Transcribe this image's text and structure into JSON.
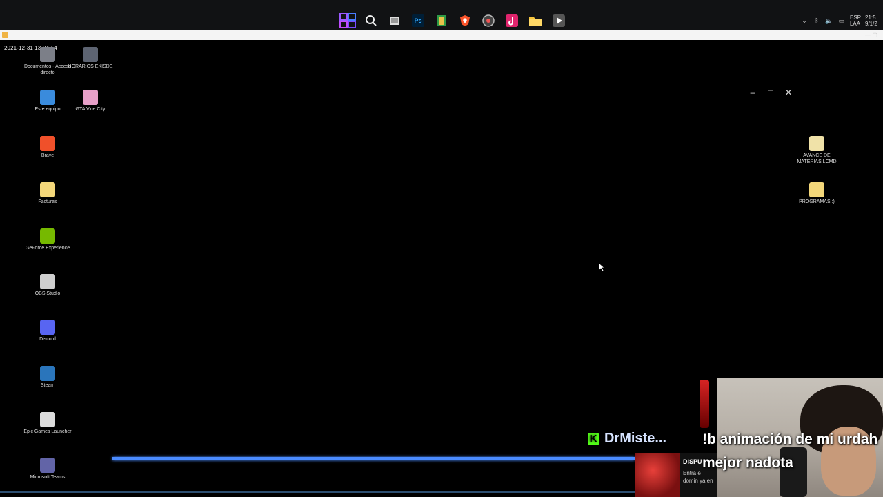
{
  "taskbar": {
    "apps": [
      {
        "name": "start",
        "icon": "windows-start-icon"
      },
      {
        "name": "search",
        "icon": "search-icon"
      },
      {
        "name": "task-view",
        "icon": "task-view-icon"
      },
      {
        "name": "photoshop",
        "icon": "photoshop-icon",
        "text": "Ps"
      },
      {
        "name": "app-green",
        "icon": "app-icon"
      },
      {
        "name": "brave",
        "icon": "brave-icon"
      },
      {
        "name": "app-grey",
        "icon": "app-icon"
      },
      {
        "name": "tiktok",
        "icon": "tiktok-icon"
      },
      {
        "name": "file-explorer",
        "icon": "folder-icon"
      },
      {
        "name": "player",
        "icon": "play-icon"
      }
    ],
    "tray": {
      "language_line1": "ESP",
      "language_line2": "LAA",
      "time": "21:5",
      "date": "9/1/2"
    }
  },
  "timestamp": "2021-12-31 13-34-54",
  "desktop_icons": [
    {
      "label": "Documentos - Acceso directo",
      "icon": "documents-shortcut-icon",
      "color": "#7c7f88"
    },
    {
      "label": "HORARIOS EKISDE",
      "icon": "file-icon",
      "color": "#5d6472"
    },
    {
      "label": "Este equipo",
      "icon": "computer-icon",
      "color": "#3a8bdc"
    },
    {
      "label": "GTA Vice City",
      "icon": "gta-vice-city-icon",
      "color": "#e7a0c8"
    },
    {
      "label": "Brave",
      "icon": "brave-icon",
      "color": "#f0502a"
    },
    {
      "label": "Facturas",
      "icon": "folder-icon",
      "color": "#f3d77a"
    },
    {
      "label": "GeForce Experience",
      "icon": "geforce-icon",
      "color": "#76b900"
    },
    {
      "label": "OBS Studio",
      "icon": "obs-icon",
      "color": "#cfcfcf"
    },
    {
      "label": "Discord",
      "icon": "discord-icon",
      "color": "#5865f2"
    },
    {
      "label": "Steam",
      "icon": "steam-icon",
      "color": "#2a75bb"
    },
    {
      "label": "Epic Games Launcher",
      "icon": "epic-games-icon",
      "color": "#dcdcdc"
    },
    {
      "label": "Microsoft Teams",
      "icon": "teams-icon",
      "color": "#6264a7"
    },
    {
      "label": "AVANCE DE MATERIAS LCMD",
      "icon": "file-icon",
      "color": "#f0e2a8"
    },
    {
      "label": "PROGRAMAS :)",
      "icon": "folder-icon",
      "color": "#f3d77a"
    }
  ],
  "window_controls": {
    "minimize": "–",
    "maximize": "□",
    "close": "✕"
  },
  "chat": {
    "username": "DrMiste...",
    "platform_icon": "K",
    "message": "!b animación de mi urdah mejor nadota",
    "platform_color": "#53fc18"
  },
  "ad": {
    "title": "DISPU",
    "text": "Entra e domin ya en"
  },
  "colors": {
    "progress": "#4a8bff",
    "taskbar": "#111214"
  }
}
